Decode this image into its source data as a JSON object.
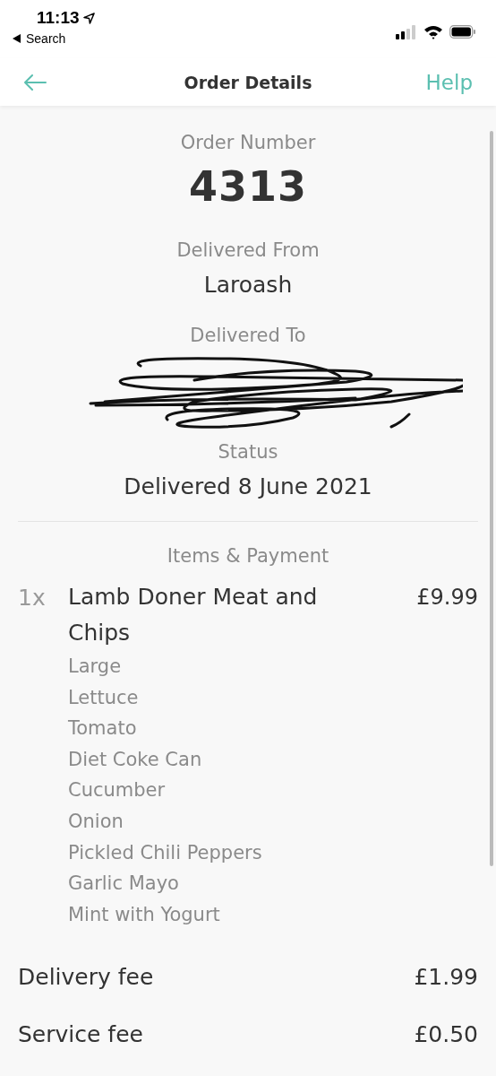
{
  "status_bar": {
    "time": "11:13",
    "back_label": "Search"
  },
  "nav": {
    "title": "Order Details",
    "help": "Help"
  },
  "order": {
    "number_label": "Order Number",
    "number": "4313",
    "from_label": "Delivered From",
    "from": "Laroash",
    "to_label": "Delivered To",
    "status_label": "Status",
    "status": "Delivered 8 June 2021"
  },
  "items_heading": "Items & Payment",
  "items": [
    {
      "quantity": "1x",
      "name": "Lamb Doner Meat and Chips",
      "price": "£9.99",
      "options": [
        "Large",
        "Lettuce",
        "Tomato",
        "Diet Coke Can",
        "Cucumber",
        "Onion",
        "Pickled Chili Peppers",
        "Garlic Mayo",
        "Mint with Yogurt"
      ]
    }
  ],
  "fees": [
    {
      "label": "Delivery fee",
      "amount": "£1.99"
    },
    {
      "label": "Service fee",
      "amount": "£0.50"
    }
  ]
}
